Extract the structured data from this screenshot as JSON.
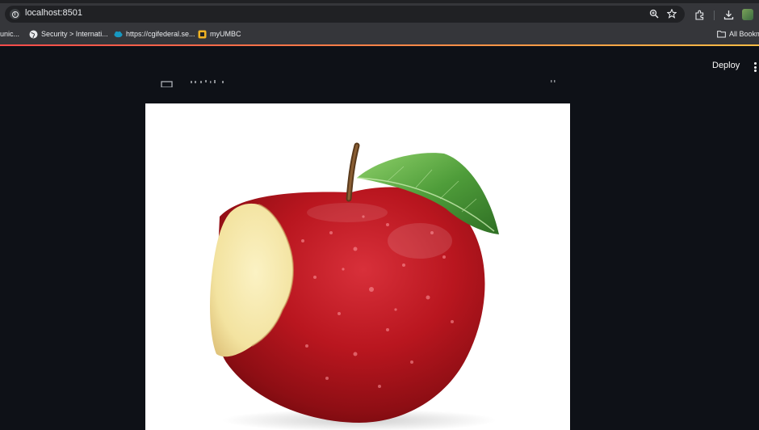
{
  "browser": {
    "url": "localhost:8501",
    "icons": [
      "info-icon",
      "zoom-icon",
      "star-icon",
      "extensions-icon",
      "download-icon",
      "profile-icon"
    ]
  },
  "bookmarks": [
    {
      "label": "unic...",
      "icon": "none"
    },
    {
      "label": "Security > Internati...",
      "icon": "globe-icon"
    },
    {
      "label": "https://cgifederal.se...",
      "icon": "salesforce-cloud-icon",
      "color": "#1798c1"
    },
    {
      "label": "myUMBC",
      "icon": "umbc-icon",
      "color": "#f0b323"
    },
    {
      "label": "All Bookm",
      "icon": "folder-icon"
    }
  ],
  "app": {
    "deploy_label": "Deploy",
    "menu_icon": "kebab-menu-icon",
    "image_subject": "apple-image"
  },
  "colors": {
    "app_background": "#0e1117",
    "chrome": "#35363a",
    "accent_gradient": [
      "#ff4b4b",
      "#ffbd45"
    ]
  }
}
